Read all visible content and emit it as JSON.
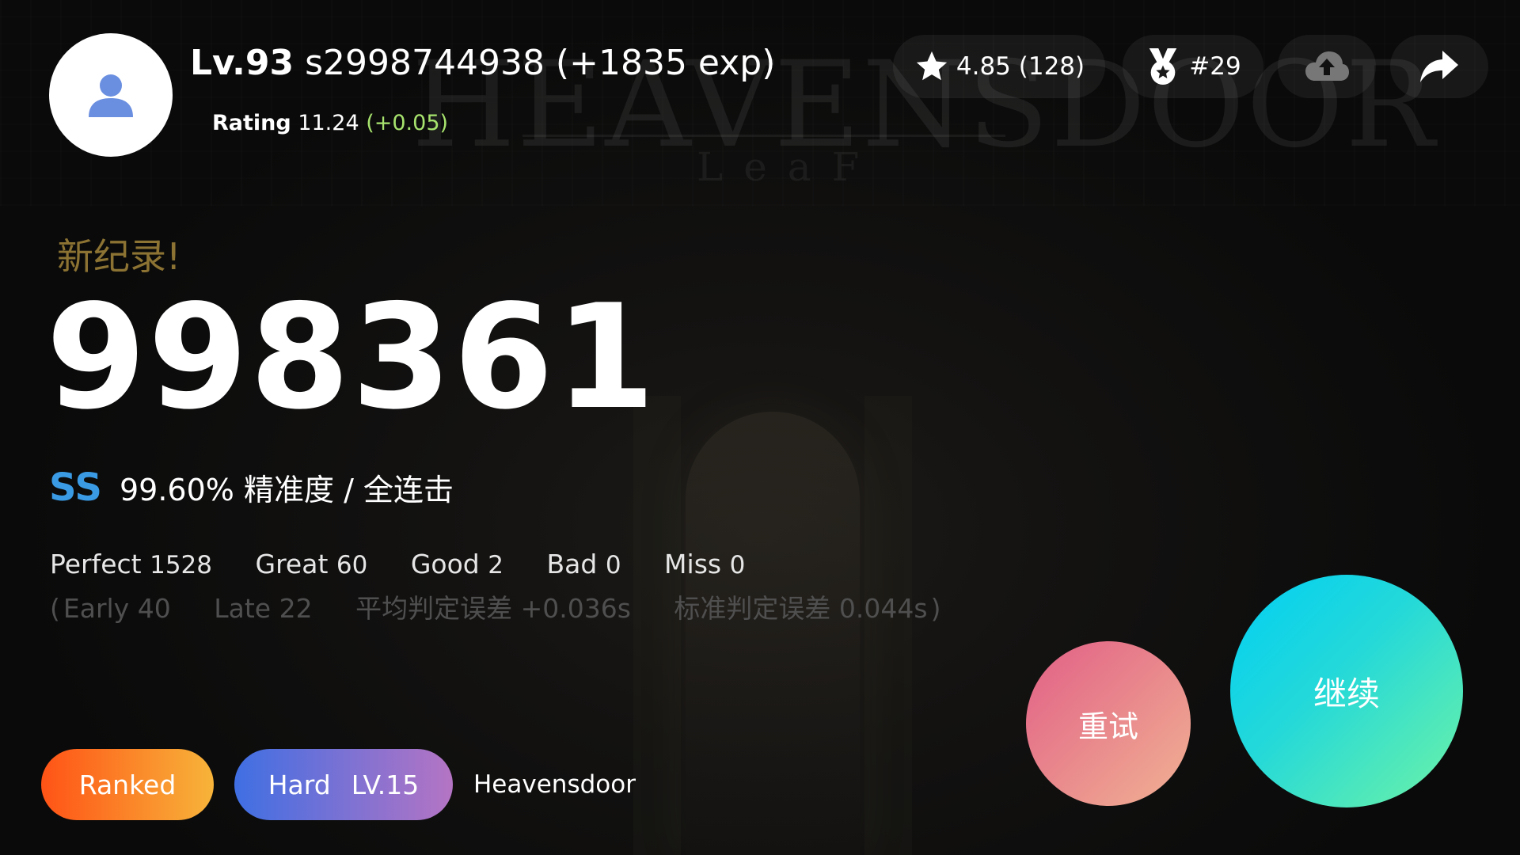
{
  "player": {
    "level": "Lv.93",
    "name_exp": "s2998744938 (+1835 exp)",
    "rating_label": "Rating",
    "rating_value": "11.24",
    "rating_delta": "(+0.05)",
    "avatar_icon": "user-icon"
  },
  "header": {
    "chart_rating": "4.85 (128)",
    "rank": "#29",
    "star_icon": "star-icon",
    "medal_icon": "medal-icon",
    "upload_icon": "cloud-upload-icon",
    "share_icon": "share-icon"
  },
  "result": {
    "new_record": "新纪录!",
    "score": "998361",
    "grade": "SS",
    "accuracy": "99.60%",
    "accuracy_label": "精准度",
    "separator": "/",
    "combo_status": "全连击",
    "grade_color": "#3a9be4"
  },
  "judgements": {
    "perfect_label": "Perfect",
    "perfect": "1528",
    "great_label": "Great",
    "great": "60",
    "good_label": "Good",
    "good": "2",
    "bad_label": "Bad",
    "bad": "0",
    "miss_label": "Miss",
    "miss": "0"
  },
  "details": {
    "open_paren": "(",
    "early_label": "Early",
    "early": "40",
    "late_label": "Late",
    "late": "22",
    "mean_offset_label": "平均判定误差",
    "mean_offset": "+0.036s",
    "std_offset_label": "标准判定误差",
    "std_offset": "0.044s",
    "close_paren": ")"
  },
  "tags": {
    "mode": "Ranked",
    "difficulty": "Hard",
    "difficulty_level": "LV.15",
    "song": "Heavensdoor"
  },
  "background": {
    "title": "HEAVENSDOOR",
    "subtitle": "LeaF"
  },
  "buttons": {
    "retry": "重试",
    "continue": "继续"
  }
}
